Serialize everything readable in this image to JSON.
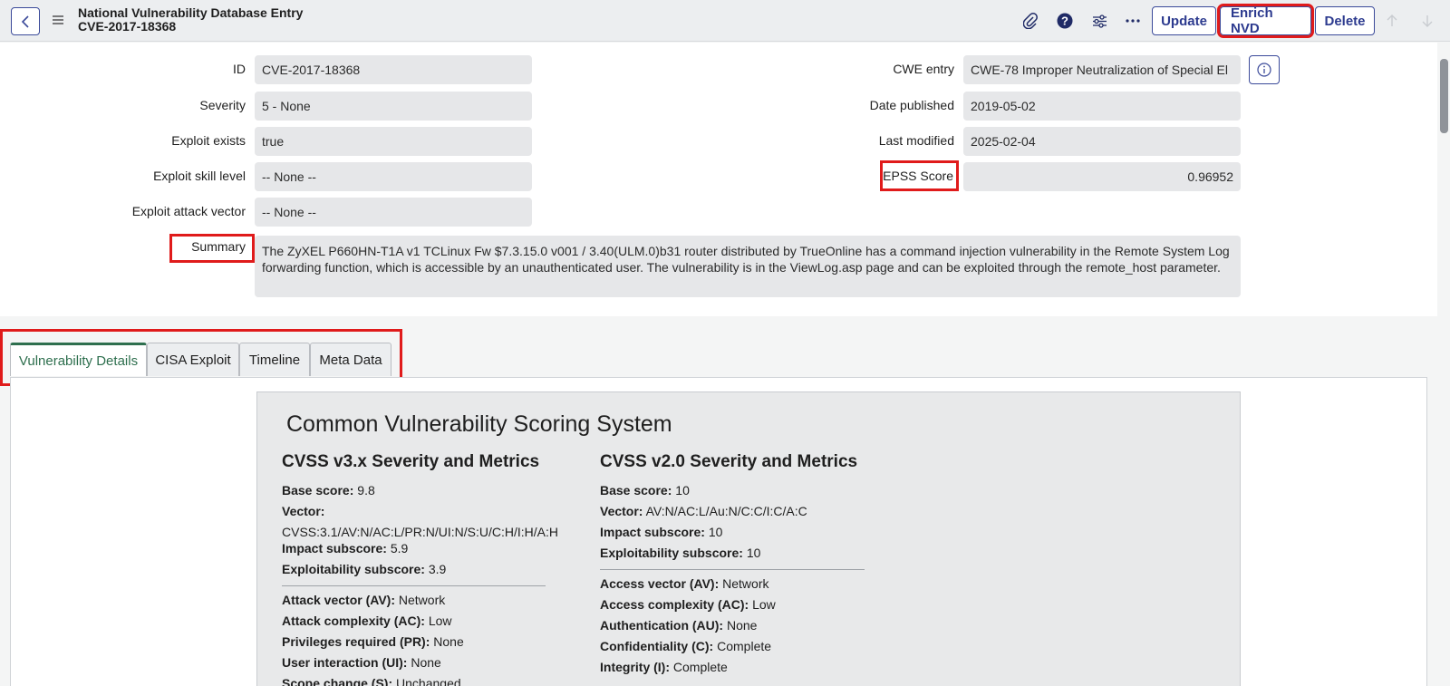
{
  "header": {
    "title_line1": "National Vulnerability Database Entry",
    "title_line2": "CVE-2017-18368",
    "buttons": {
      "update": "Update",
      "enrich": "Enrich NVD",
      "delete": "Delete"
    },
    "icons": [
      "chevron-left-icon",
      "hamburger-menu-icon",
      "paperclip-icon",
      "help-icon",
      "sliders-icon",
      "more-icon",
      "arrow-up-icon",
      "arrow-down-icon"
    ]
  },
  "form": {
    "id_label": "ID",
    "id_value": "CVE-2017-18368",
    "severity_label": "Severity",
    "severity_value": "5 - None",
    "exploit_exists_label": "Exploit exists",
    "exploit_exists_value": "true",
    "exploit_skill_label": "Exploit skill level",
    "exploit_skill_value": "-- None --",
    "exploit_vector_label": "Exploit attack vector",
    "exploit_vector_value": "-- None --",
    "cwe_label": "CWE entry",
    "cwe_value": "CWE-78 Improper Neutralization of Special El",
    "published_label": "Date published",
    "published_value": "2019-05-02",
    "modified_label": "Last modified",
    "modified_value": "2025-02-04",
    "epss_label": "EPSS Score",
    "epss_value": "0.96952",
    "summary_label": "Summary",
    "summary_value": "The ZyXEL P660HN-T1A v1 TCLinux Fw $7.3.15.0 v001 / 3.40(ULM.0)b31 router distributed by TrueOnline has a command injection vulnerability in the Remote System Log forwarding function, which is accessible by an unauthenticated user. The vulnerability is in the ViewLog.asp page and can be exploited through the remote_host parameter."
  },
  "tabs": [
    "Vulnerability Details",
    "CISA Exploit",
    "Timeline",
    "Meta Data"
  ],
  "cvss": {
    "title": "Common Vulnerability Scoring System",
    "v3": {
      "heading": "CVSS v3.x Severity and Metrics",
      "base_score_label": "Base score:",
      "base_score": "9.8",
      "vector_label": "Vector:",
      "vector": "CVSS:3.1/AV:N/AC:L/PR:N/UI:N/S:U/C:H/I:H/A:H",
      "impact_label": "Impact subscore:",
      "impact": "5.9",
      "exploitability_label": "Exploitability subscore:",
      "exploitability": "3.9",
      "av_label": "Attack vector (AV):",
      "av": "Network",
      "ac_label": "Attack complexity (AC):",
      "ac": "Low",
      "pr_label": "Privileges required (PR):",
      "pr": "None",
      "ui_label": "User interaction (UI):",
      "ui": "None",
      "s_label": "Scope change (S):",
      "s": "Unchanged"
    },
    "v2": {
      "heading": "CVSS v2.0 Severity and Metrics",
      "base_score_label": "Base score:",
      "base_score": "10",
      "vector_label": "Vector:",
      "vector": "AV:N/AC:L/Au:N/C:C/I:C/A:C",
      "impact_label": "Impact subscore:",
      "impact": "10",
      "exploitability_label": "Exploitability subscore:",
      "exploitability": "10",
      "av_label": "Access vector (AV):",
      "av": "Network",
      "ac_label": "Access complexity (AC):",
      "ac": "Low",
      "au_label": "Authentication (AU):",
      "au": "None",
      "c_label": "Confidentiality (C):",
      "c": "Complete",
      "i_label": "Integrity (I):",
      "i": "Complete"
    }
  }
}
